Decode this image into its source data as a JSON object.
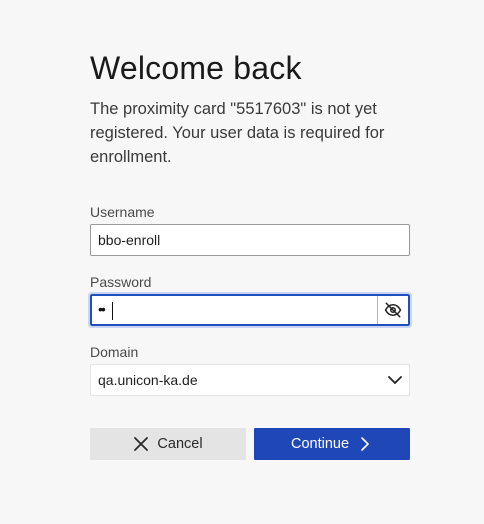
{
  "header": {
    "title": "Welcome back"
  },
  "message": {
    "text": "The proximity card \"5517603\" is not yet registered. Your user data is required for enrollment."
  },
  "form": {
    "username": {
      "label": "Username",
      "value": "bbo-enroll"
    },
    "password": {
      "label": "Password",
      "masked_value": "••",
      "toggle_icon": "eye-off-icon"
    },
    "domain": {
      "label": "Domain",
      "selected": "qa.unicon-ka.de",
      "dropdown_icon": "chevron-down-icon"
    }
  },
  "actions": {
    "cancel_label": "Cancel",
    "cancel_icon": "close-icon",
    "continue_label": "Continue",
    "continue_icon": "chevron-right-icon"
  },
  "colors": {
    "background": "#f7f7f7",
    "primary": "#1f47b8",
    "focus_border": "#1f4fbf",
    "secondary_button": "#e4e4e4"
  }
}
